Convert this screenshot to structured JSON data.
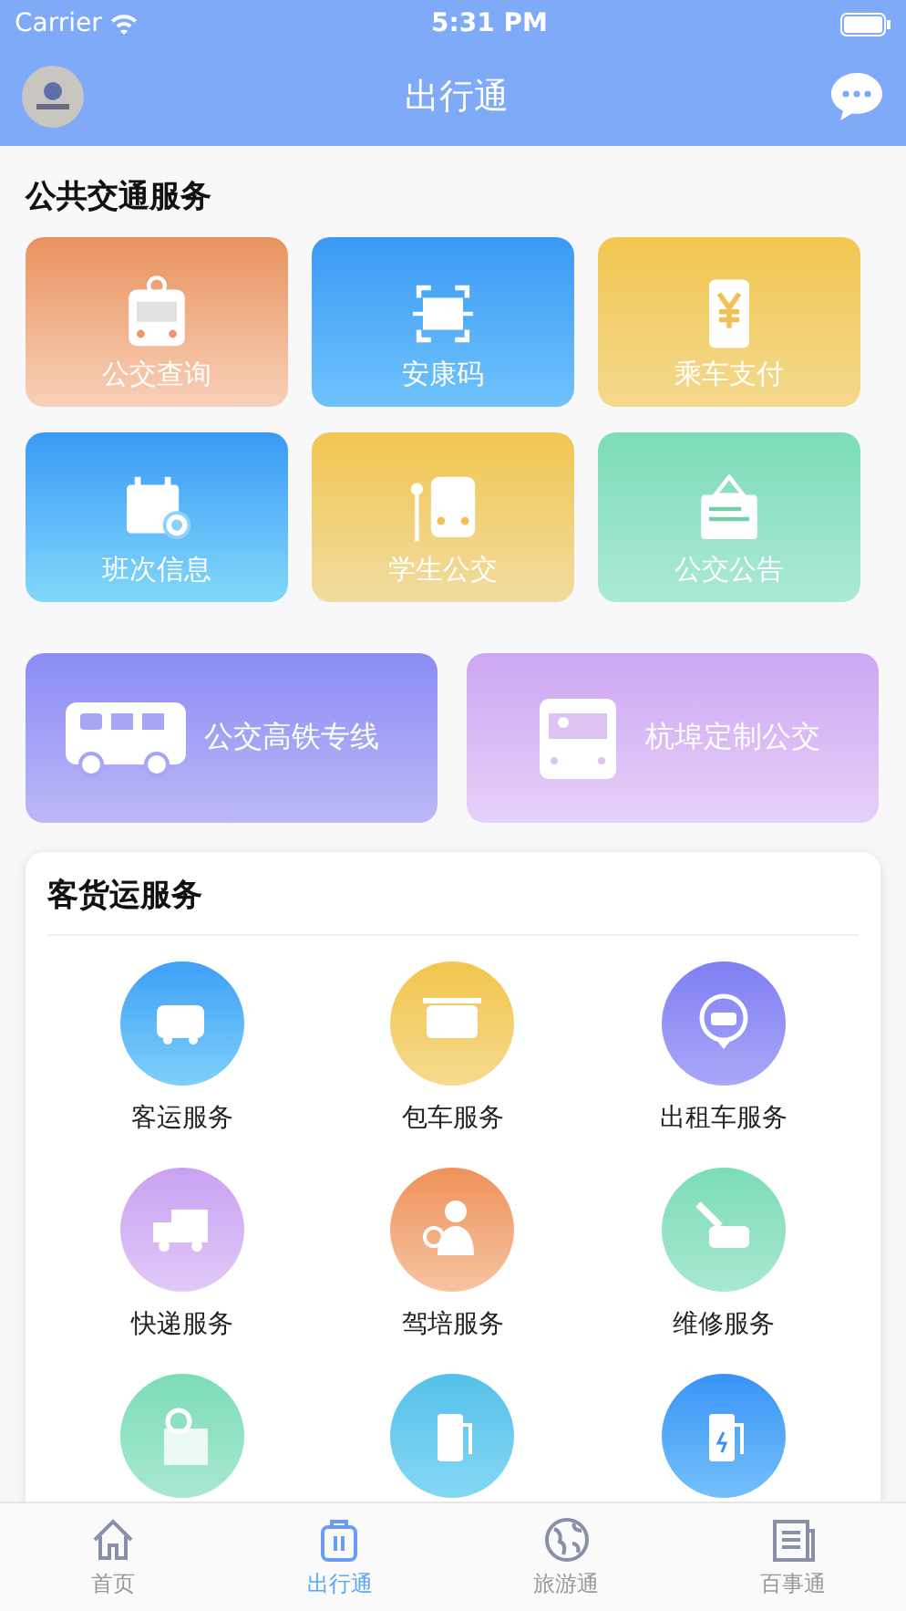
{
  "status_bar": {
    "carrier": "Carrier",
    "time": "5:31 PM"
  },
  "nav_bar": {
    "title": "出行通"
  },
  "public_transit": {
    "title": "公共交通服务",
    "tiles": [
      {
        "label": "公交查询"
      },
      {
        "label": "安康码"
      },
      {
        "label": "乘车支付"
      },
      {
        "label": "班次信息"
      },
      {
        "label": "学生公交"
      },
      {
        "label": "公交公告"
      }
    ],
    "wide_tiles": [
      {
        "label": "公交高铁专线"
      },
      {
        "label": "杭埠定制公交"
      }
    ]
  },
  "freight": {
    "title": "客货运服务",
    "services": [
      {
        "kind": "service",
        "label": "客运服务"
      },
      {
        "kind": "service",
        "label": "包车服务"
      },
      {
        "kind": "service",
        "label": "出租车服务"
      },
      {
        "kind": "service",
        "label": "快递服务"
      },
      {
        "kind": "service",
        "label": "驾培服务"
      },
      {
        "kind": "service",
        "label": "维修服务"
      },
      {
        "kind": "partial"
      },
      {
        "kind": "partial"
      },
      {
        "kind": "partial"
      }
    ]
  },
  "tab_bar": [
    {
      "label": "首页",
      "selected": false
    },
    {
      "label": "出行通",
      "selected": true
    },
    {
      "label": "旅游通",
      "selected": false
    },
    {
      "label": "百事通",
      "selected": false
    }
  ]
}
